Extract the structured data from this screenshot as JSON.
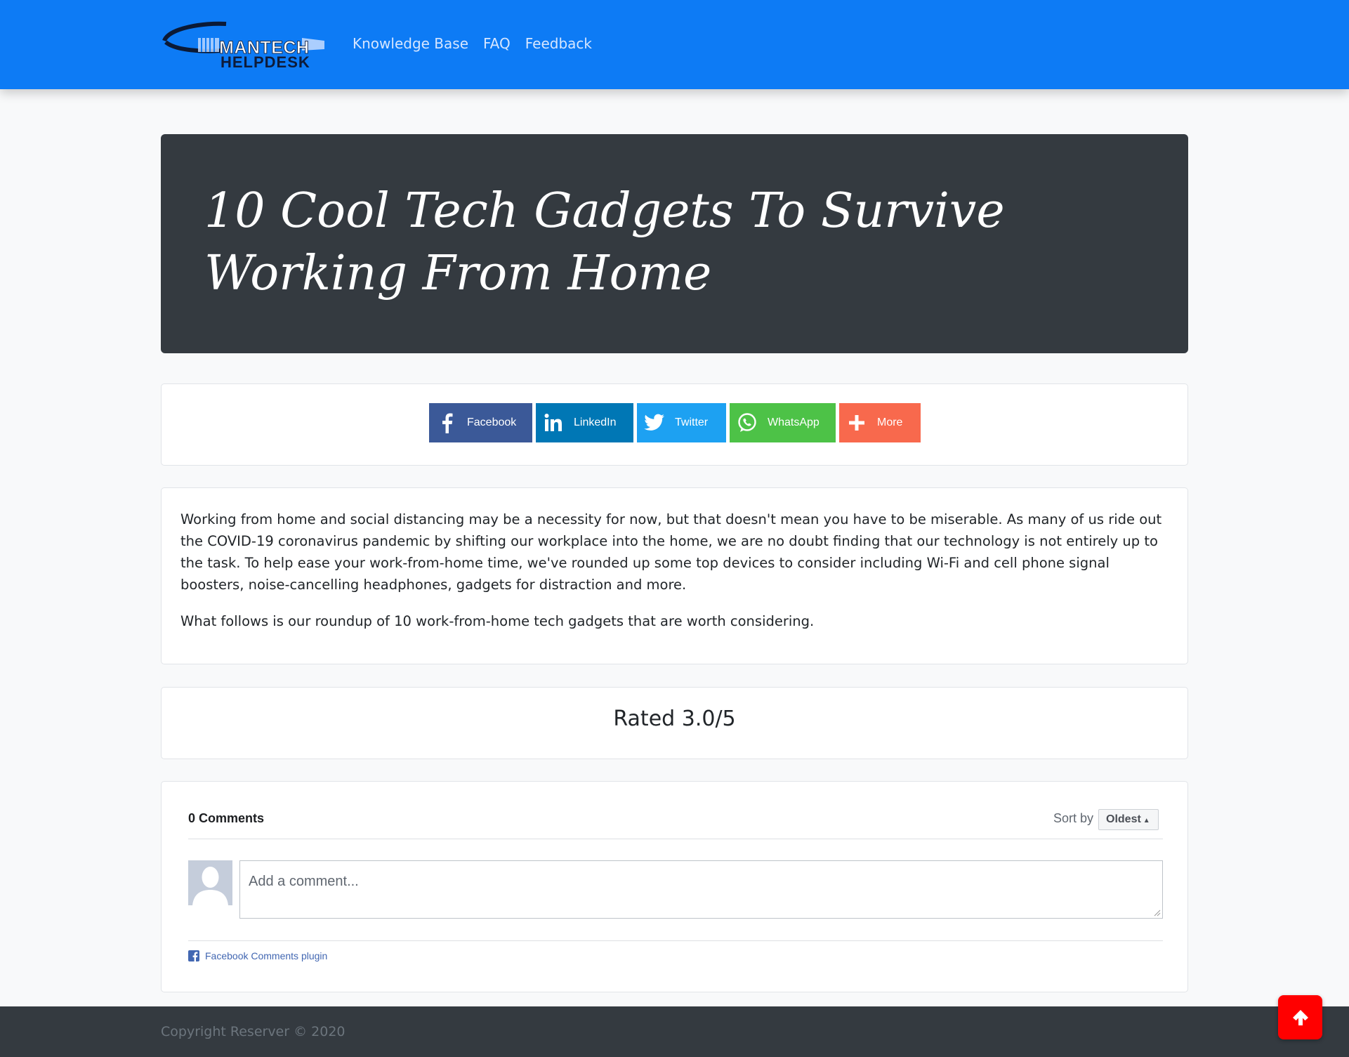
{
  "navbar": {
    "logo_line1": "MANTECH",
    "logo_line2": "HELPDESK",
    "links": [
      "Knowledge Base",
      "FAQ",
      "Feedback"
    ]
  },
  "hero": {
    "title": "10 Cool Tech Gadgets To Survive Working From Home"
  },
  "share": {
    "buttons": [
      {
        "label": "Facebook",
        "icon": "facebook-icon",
        "color": "#3b5998"
      },
      {
        "label": "LinkedIn",
        "icon": "linkedin-icon",
        "color": "#0077b5"
      },
      {
        "label": "Twitter",
        "icon": "twitter-icon",
        "color": "#1da1f2"
      },
      {
        "label": "WhatsApp",
        "icon": "whatsapp-icon",
        "color": "#4dc247"
      },
      {
        "label": "More",
        "icon": "plus-icon",
        "color": "#f8694d"
      }
    ]
  },
  "article": {
    "paragraph1": "Working from home and social distancing may be a necessity for now, but that doesn't mean you have to be miserable. As many of us ride out the COVID-19 coronavirus pandemic by shifting our workplace into the home, we are no doubt finding that our technology is not entirely up to the task. To help ease your work-from-home time, we've rounded up some top devices to consider including Wi-Fi and cell phone signal boosters, noise-cancelling headphones, gadgets for distraction and more.",
    "paragraph2": "What follows is our roundup of 10 work-from-home tech gadgets that are worth considering."
  },
  "rating": {
    "text": "Rated 3.0/5"
  },
  "comments": {
    "count_label": "0 Comments",
    "sort_label": "Sort by",
    "sort_value": "Oldest",
    "placeholder": "Add a comment...",
    "plugin_label": "Facebook Comments plugin"
  },
  "footer": {
    "copyright": "Copyright Reserver © 2020"
  },
  "colors": {
    "navbar": "#0d7bf5",
    "hero": "#343a40",
    "back_to_top": "#ff0000"
  }
}
